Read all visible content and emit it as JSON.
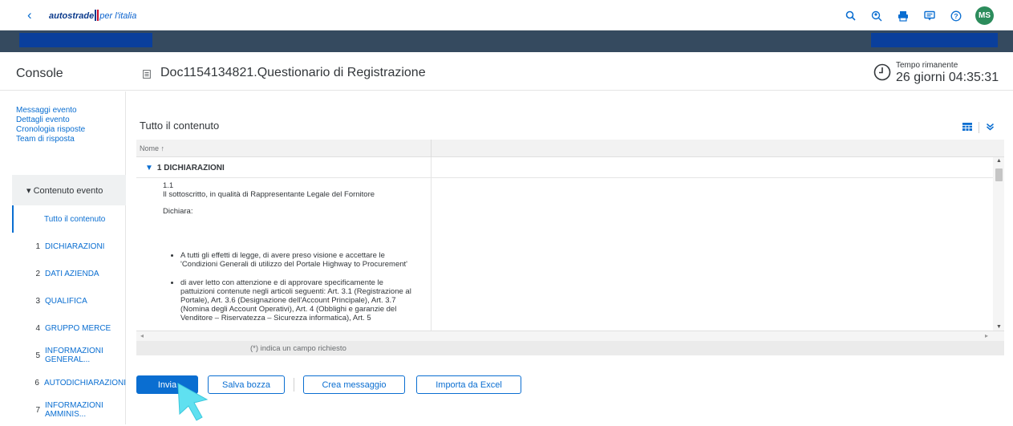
{
  "topbar": {
    "back_glyph": "‹",
    "logo_main": "autostrade",
    "logo_sub": "per l'italia",
    "icons": [
      "search-icon",
      "user-search-icon",
      "print-icon",
      "chat-icon",
      "help-icon"
    ],
    "avatar_initials": "MS"
  },
  "header": {
    "console_label": "Console",
    "doc_title": "Doc1154134821.Questionario di Registrazione",
    "tempo_label": "Tempo rimanente",
    "tempo_value": "26 giorni 04:35:31"
  },
  "sidebar": {
    "links": [
      "Messaggi evento",
      "Dettagli evento",
      "Cronologia risposte",
      "Team di risposta"
    ],
    "section_label": "▾ Contenuto evento",
    "nav": [
      {
        "num": "",
        "label": "Tutto il contenuto",
        "active": true
      },
      {
        "num": "1",
        "label": "DICHIARAZIONI"
      },
      {
        "num": "2",
        "label": "DATI AZIENDA"
      },
      {
        "num": "3",
        "label": "QUALIFICA"
      },
      {
        "num": "4",
        "label": "GRUPPO MERCE"
      },
      {
        "num": "5",
        "label_line1": "INFORMAZIONI",
        "label_line2": "GENERAL..."
      },
      {
        "num": "6",
        "label": "AUTODICHIARAZIONI"
      },
      {
        "num": "7",
        "label_line1": "INFORMAZIONI",
        "label_line2": "AMMINIS..."
      }
    ]
  },
  "content": {
    "section_title": "Tutto il contenuto",
    "column_header": "Nome ↑",
    "group_row": "1  DICHIARAZIONI",
    "question": {
      "number": "1.1",
      "line1": "Il sottoscritto, in qualità di Rappresentante Legale del Fornitore",
      "line2": "Dichiara:",
      "bullet1": "A tutti gli effetti di legge, di avere preso visione e accettare le 'Condizioni Generali di utilizzo del Portale Highway to Procurement'",
      "bullet2": "di aver letto con attenzione e di approvare specificamente le pattuizioni contenute negli articoli seguenti: Art. 3.1 (Registrazione al Portale), Art. 3.6 (Designazione dell'Account Principale), Art. 3.7 (Nomina degli Account Operativi), Art. 4 (Obblighi e garanzie del Venditore – Riservatezza – Sicurezza informatica), Art. 5"
    },
    "required_note": "(*) indica un campo richiesto"
  },
  "actions": {
    "send": "Invia",
    "save_draft": "Salva bozza",
    "create_message": "Crea messaggio",
    "import_excel": "Importa da Excel"
  },
  "colors": {
    "accent": "#0a6ed1",
    "shell_dark": "#354a5f",
    "avatar": "#2c8c5c"
  }
}
